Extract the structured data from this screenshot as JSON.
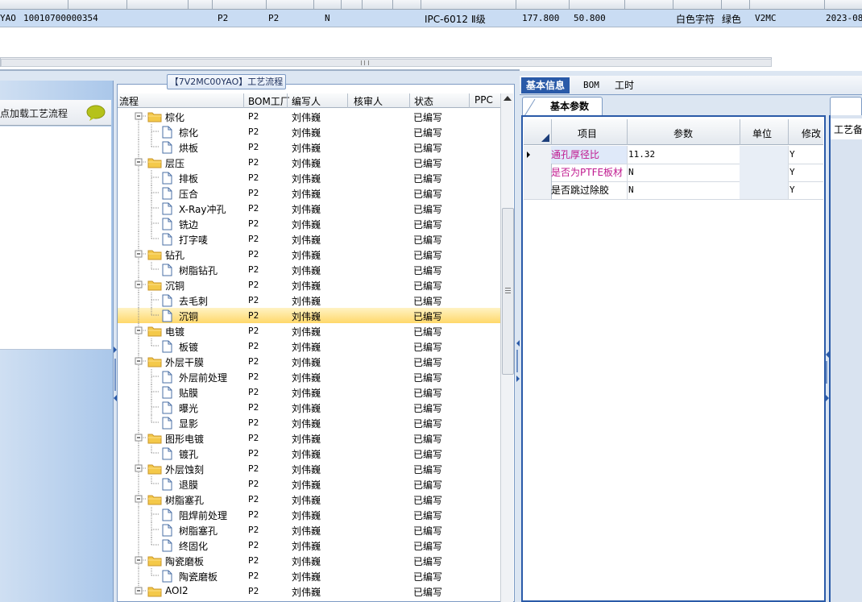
{
  "top_grid": {
    "row": {
      "code_suffix": "YAO",
      "number": "10010700000354",
      "col_p2a": "P2",
      "col_p2b": "P2",
      "col_n": "N",
      "material": "IPC-6012 Ⅱ级",
      "val1": "177.800",
      "val2": "50.800",
      "silkscreen": "白色字符",
      "color": "绿色",
      "code": "V2MC",
      "date": "2023-08-"
    }
  },
  "left_panel": {
    "header_text": "点加载工艺流程"
  },
  "tree": {
    "title": "【7V2MC00YAO】工艺流程",
    "columns": {
      "flow": "流程",
      "bom_factory": "BOM工厂",
      "author": "编写人",
      "reviewer": "核审人",
      "status": "状态",
      "ppc": "PPC"
    },
    "rows": [
      {
        "name": "棕化",
        "level": 0,
        "bom": "P2",
        "author": "刘伟巍",
        "status": "已编写"
      },
      {
        "name": "棕化",
        "level": 1,
        "bom": "P2",
        "author": "刘伟巍",
        "status": "已编写"
      },
      {
        "name": "烘板",
        "level": 1,
        "bom": "P2",
        "author": "刘伟巍",
        "status": "已编写",
        "last": true
      },
      {
        "name": "层压",
        "level": 0,
        "bom": "P2",
        "author": "刘伟巍",
        "status": "已编写"
      },
      {
        "name": "排板",
        "level": 1,
        "bom": "P2",
        "author": "刘伟巍",
        "status": "已编写"
      },
      {
        "name": "压合",
        "level": 1,
        "bom": "P2",
        "author": "刘伟巍",
        "status": "已编写"
      },
      {
        "name": "X-Ray冲孔",
        "level": 1,
        "bom": "P2",
        "author": "刘伟巍",
        "status": "已编写"
      },
      {
        "name": "铣边",
        "level": 1,
        "bom": "P2",
        "author": "刘伟巍",
        "status": "已编写"
      },
      {
        "name": "打字唛",
        "level": 1,
        "bom": "P2",
        "author": "刘伟巍",
        "status": "已编写",
        "last": true
      },
      {
        "name": "钻孔",
        "level": 0,
        "bom": "P2",
        "author": "刘伟巍",
        "status": "已编写"
      },
      {
        "name": "树脂钻孔",
        "level": 1,
        "bom": "P2",
        "author": "刘伟巍",
        "status": "已编写",
        "last": true
      },
      {
        "name": "沉铜",
        "level": 0,
        "bom": "P2",
        "author": "刘伟巍",
        "status": "已编写"
      },
      {
        "name": "去毛刺",
        "level": 1,
        "bom": "P2",
        "author": "刘伟巍",
        "status": "已编写"
      },
      {
        "name": "沉铜",
        "level": 1,
        "bom": "P2",
        "author": "刘伟巍",
        "status": "已编写",
        "last": true,
        "selected": true
      },
      {
        "name": "电镀",
        "level": 0,
        "bom": "P2",
        "author": "刘伟巍",
        "status": "已编写"
      },
      {
        "name": "板镀",
        "level": 1,
        "bom": "P2",
        "author": "刘伟巍",
        "status": "已编写",
        "last": true
      },
      {
        "name": "外层干膜",
        "level": 0,
        "bom": "P2",
        "author": "刘伟巍",
        "status": "已编写"
      },
      {
        "name": "外层前处理",
        "level": 1,
        "bom": "P2",
        "author": "刘伟巍",
        "status": "已编写"
      },
      {
        "name": "贴膜",
        "level": 1,
        "bom": "P2",
        "author": "刘伟巍",
        "status": "已编写"
      },
      {
        "name": "曝光",
        "level": 1,
        "bom": "P2",
        "author": "刘伟巍",
        "status": "已编写"
      },
      {
        "name": "显影",
        "level": 1,
        "bom": "P2",
        "author": "刘伟巍",
        "status": "已编写",
        "last": true
      },
      {
        "name": "图形电镀",
        "level": 0,
        "bom": "P2",
        "author": "刘伟巍",
        "status": "已编写"
      },
      {
        "name": "镀孔",
        "level": 1,
        "bom": "P2",
        "author": "刘伟巍",
        "status": "已编写",
        "last": true
      },
      {
        "name": "外层蚀刻",
        "level": 0,
        "bom": "P2",
        "author": "刘伟巍",
        "status": "已编写"
      },
      {
        "name": "退膜",
        "level": 1,
        "bom": "P2",
        "author": "刘伟巍",
        "status": "已编写",
        "last": true
      },
      {
        "name": "树脂塞孔",
        "level": 0,
        "bom": "P2",
        "author": "刘伟巍",
        "status": "已编写"
      },
      {
        "name": "阻焊前处理",
        "level": 1,
        "bom": "P2",
        "author": "刘伟巍",
        "status": "已编写"
      },
      {
        "name": "树脂塞孔",
        "level": 1,
        "bom": "P2",
        "author": "刘伟巍",
        "status": "已编写"
      },
      {
        "name": "终固化",
        "level": 1,
        "bom": "P2",
        "author": "刘伟巍",
        "status": "已编写",
        "last": true
      },
      {
        "name": "陶瓷磨板",
        "level": 0,
        "bom": "P2",
        "author": "刘伟巍",
        "status": "已编写"
      },
      {
        "name": "陶瓷磨板",
        "level": 1,
        "bom": "P2",
        "author": "刘伟巍",
        "status": "已编写",
        "last": true
      },
      {
        "name": "AOI2",
        "level": 0,
        "bom": "P2",
        "author": "刘伟巍",
        "status": "已编写"
      }
    ]
  },
  "right_panel": {
    "tabs": [
      "基本信息",
      "BOM",
      "工时"
    ],
    "sub_tab": "基本参数",
    "side_tab": "工艺备",
    "grid_columns": {
      "item": "项目",
      "param": "参数",
      "unit": "单位",
      "modify": "修改"
    },
    "grid_rows": [
      {
        "item": "通孔厚径比",
        "param": "11.32",
        "unit": "",
        "modify": "Y",
        "item_color": "#c0198f",
        "current": true
      },
      {
        "item": "是否为PTFE板材",
        "param": "N",
        "unit": "",
        "modify": "Y",
        "item_color": "#c0198f",
        "current": false
      },
      {
        "item": "是否跳过除胶",
        "param": "N",
        "unit": "",
        "modify": "Y",
        "item_color": "#000000",
        "current": false
      }
    ]
  }
}
